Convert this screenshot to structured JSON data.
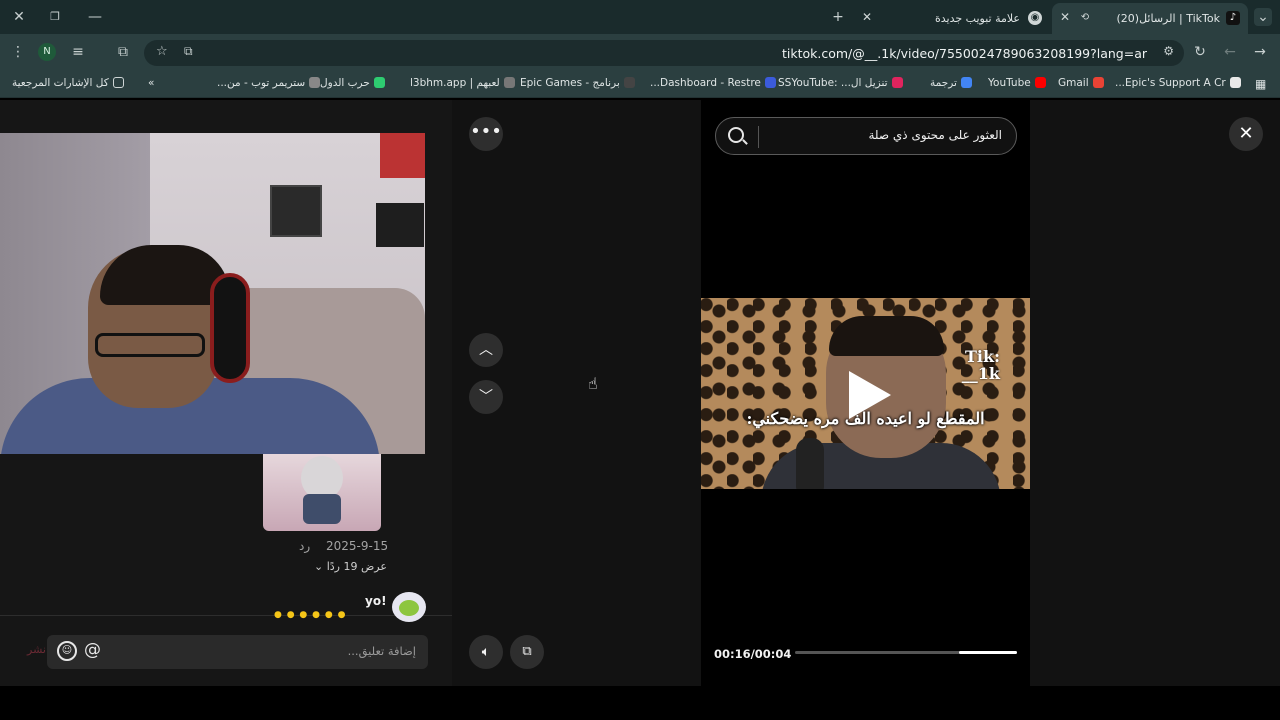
{
  "browser": {
    "tabs": [
      {
        "title": "TikTok | الرسائل(20)",
        "active": true
      },
      {
        "title": "علامة تبويب جديدة",
        "active": false
      }
    ],
    "url": "tiktok.com/@__.1k/video/7550024789063208199?lang=ar",
    "profile_initial": "N",
    "bookmarks": [
      {
        "label": "Epic's Support A Cr...",
        "color": "#e9e9e9"
      },
      {
        "label": "Gmail",
        "color": "#ea4335"
      },
      {
        "label": "YouTube",
        "color": "#ff0000"
      },
      {
        "label": "ترجمة",
        "color": "#4285f4"
      },
      {
        "label": "تنزيل ال... :SSYouTube",
        "color": "#e0245e"
      },
      {
        "label": "Dashboard - Restre...",
        "color": "#3b5bdb"
      },
      {
        "label": "برنامج - Epic Games",
        "color": "#2b2b2b"
      },
      {
        "label": "لعبهم | l3bhm.app",
        "color": "#777777"
      },
      {
        "label": "حرب الدول",
        "color": "#2ecc71"
      },
      {
        "label": "ستريمر توب - من...",
        "color": "#888888"
      }
    ],
    "all_bookmarks_label": "كل الإشارات المرجعية"
  },
  "comments": {
    "date": "2025-9-15",
    "reply_label": "رد",
    "view_replies": "عرض 19 ردًا",
    "next_user": "yo!",
    "input_placeholder": "إضافة تعليق...",
    "post_label": "نشر"
  },
  "search": {
    "placeholder": "العثور على محتوى ذي صلة"
  },
  "video": {
    "caption": "المقطع لو اعيده الف مره يضحكني:",
    "watermark_line1": "Tik:",
    "watermark_line2": "__1k",
    "time": "00:16/00:04",
    "progress_fraction": 0.26
  },
  "icons": {
    "more": "more-dots-icon",
    "up": "chevron-up-icon",
    "down": "chevron-down-icon",
    "volume": "volume-icon",
    "pip": "picture-in-picture-icon",
    "close": "close-icon",
    "search": "search-icon",
    "play": "play-icon"
  }
}
